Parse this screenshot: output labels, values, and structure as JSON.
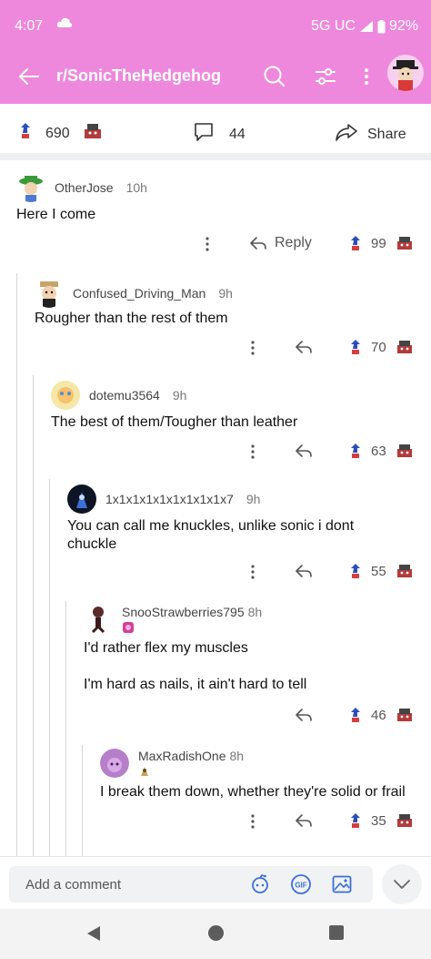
{
  "status": {
    "time": "4:07",
    "network": "5G UC",
    "battery": "92%"
  },
  "app_bar": {
    "subreddit": "r/SonicTheHedgehog"
  },
  "post": {
    "upvotes": "690",
    "comments": "44",
    "share_label": "Share"
  },
  "comments": [
    {
      "user": "OtherJose",
      "age": "10h",
      "text": "Here I come",
      "score": "99",
      "reply_label": "Reply"
    },
    {
      "user": "Confused_Driving_Man",
      "age": "9h",
      "text": "Rougher than the rest of them",
      "score": "70"
    },
    {
      "user": "dotemu3564",
      "age": "9h",
      "text": "The best of them/Tougher than leather",
      "score": "63"
    },
    {
      "user": "1x1x1x1x1x1x1x1x1x7",
      "age": "9h",
      "text_line1": "You can call me knuckles, unlike sonic i dont",
      "text_line2": "chuckle",
      "score": "55"
    },
    {
      "user": "SnooStrawberries795",
      "age": "8h",
      "text_line1": "I'd rather flex my muscles",
      "text_line2": "I'm hard as nails, it ain't hard to tell",
      "score": "46"
    },
    {
      "user": "MaxRadishOne",
      "age": "8h",
      "text": "I break them down, whether they're solid or frail",
      "score": "35"
    }
  ],
  "composer": {
    "placeholder": "Add a comment",
    "gif_label": "GIF"
  },
  "colors": {
    "header": "#ee88dd",
    "thread_line": "#d6d6d6"
  }
}
